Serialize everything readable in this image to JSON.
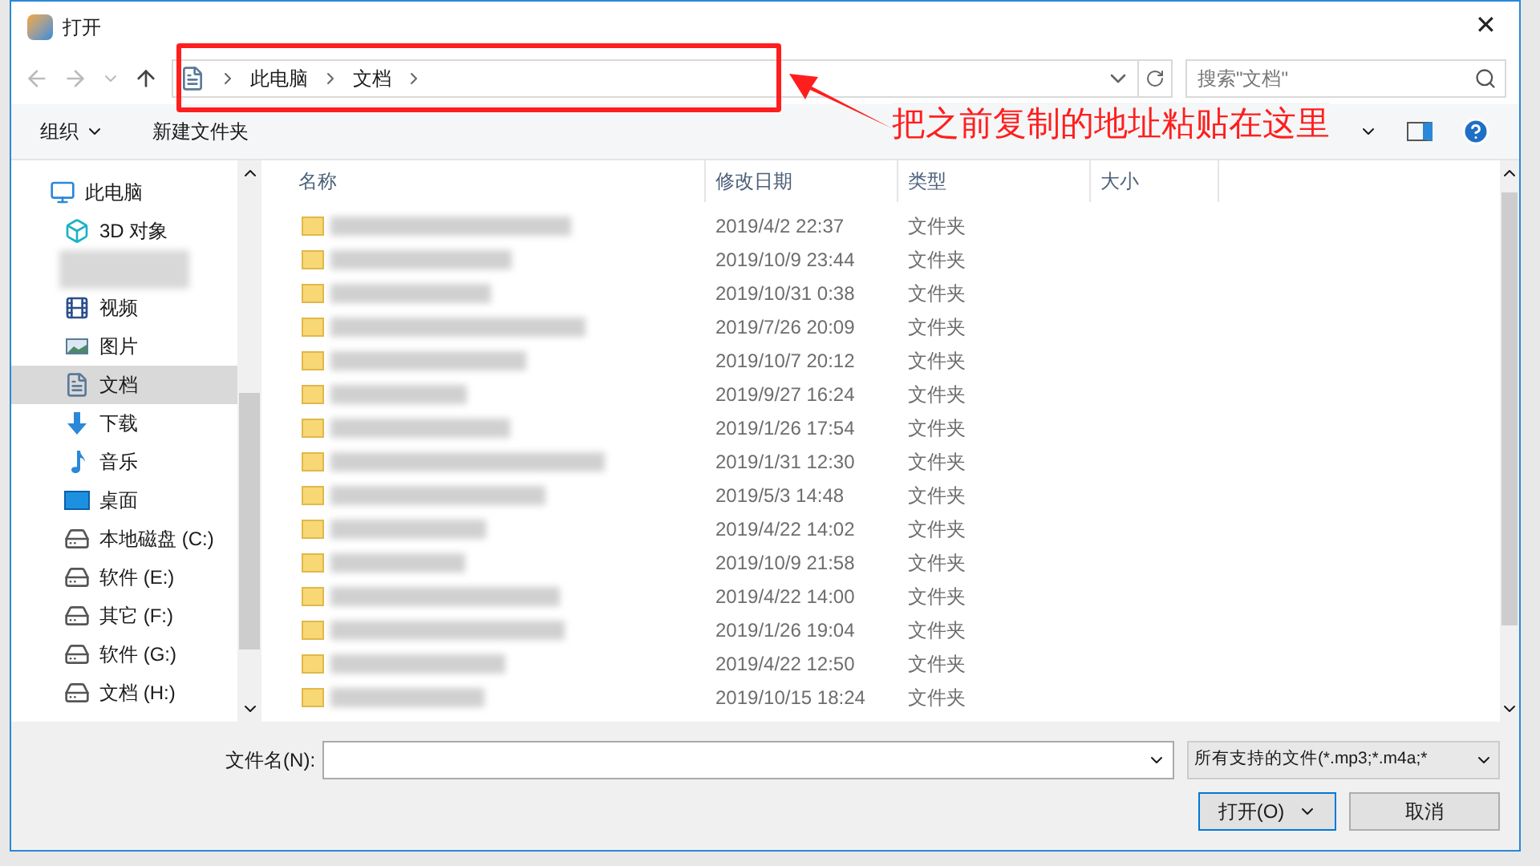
{
  "window": {
    "title": "打开",
    "close": "✕"
  },
  "address": {
    "crumbs": [
      "此电脑",
      "文档"
    ],
    "search_placeholder": "搜索\"文档\""
  },
  "toolbar": {
    "organize": "组织",
    "new_folder": "新建文件夹"
  },
  "sidebar": {
    "items": [
      {
        "kind": "pc",
        "label": "此电脑",
        "selected": false
      },
      {
        "kind": "cube",
        "label": "3D 对象",
        "selected": false
      },
      {
        "kind": "redacted",
        "selected": false
      },
      {
        "kind": "video",
        "label": "视频",
        "selected": false
      },
      {
        "kind": "picture",
        "label": "图片",
        "selected": false
      },
      {
        "kind": "doc",
        "label": "文档",
        "selected": true
      },
      {
        "kind": "download",
        "label": "下载",
        "selected": false
      },
      {
        "kind": "music",
        "label": "音乐",
        "selected": false
      },
      {
        "kind": "desktop",
        "label": "桌面",
        "selected": false
      },
      {
        "kind": "windrive",
        "label": "本地磁盘 (C:)",
        "selected": false
      },
      {
        "kind": "drive",
        "label": "软件 (E:)",
        "selected": false
      },
      {
        "kind": "drive",
        "label": "其它 (F:)",
        "selected": false
      },
      {
        "kind": "drive",
        "label": "软件 (G:)",
        "selected": false
      },
      {
        "kind": "drive",
        "label": "文档 (H:)",
        "selected": false
      }
    ]
  },
  "table": {
    "columns": [
      "名称",
      "修改日期",
      "类型",
      "大小"
    ],
    "rows": [
      {
        "date": "2019/4/2 22:37",
        "type": "文件夹"
      },
      {
        "date": "2019/10/9 23:44",
        "type": "文件夹"
      },
      {
        "date": "2019/10/31 0:38",
        "type": "文件夹"
      },
      {
        "date": "2019/7/26 20:09",
        "type": "文件夹"
      },
      {
        "date": "2019/10/7 20:12",
        "type": "文件夹"
      },
      {
        "date": "2019/9/27 16:24",
        "type": "文件夹"
      },
      {
        "date": "2019/1/26 17:54",
        "type": "文件夹"
      },
      {
        "date": "2019/1/31 12:30",
        "type": "文件夹"
      },
      {
        "date": "2019/5/3 14:48",
        "type": "文件夹"
      },
      {
        "date": "2019/4/22 14:02",
        "type": "文件夹"
      },
      {
        "date": "2019/10/9 21:58",
        "type": "文件夹"
      },
      {
        "date": "2019/4/22 14:00",
        "type": "文件夹"
      },
      {
        "date": "2019/1/26 19:04",
        "type": "文件夹"
      },
      {
        "date": "2019/4/22 12:50",
        "type": "文件夹"
      },
      {
        "date": "2019/10/15 18:24",
        "type": "文件夹"
      }
    ]
  },
  "footer": {
    "filename_label": "文件名(N):",
    "filter": "所有支持的文件(*.mp3;*.m4a;*",
    "open_button": "打开(O)",
    "cancel_button": "取消"
  },
  "annotation": {
    "text": "把之前复制的地址粘贴在这里"
  }
}
